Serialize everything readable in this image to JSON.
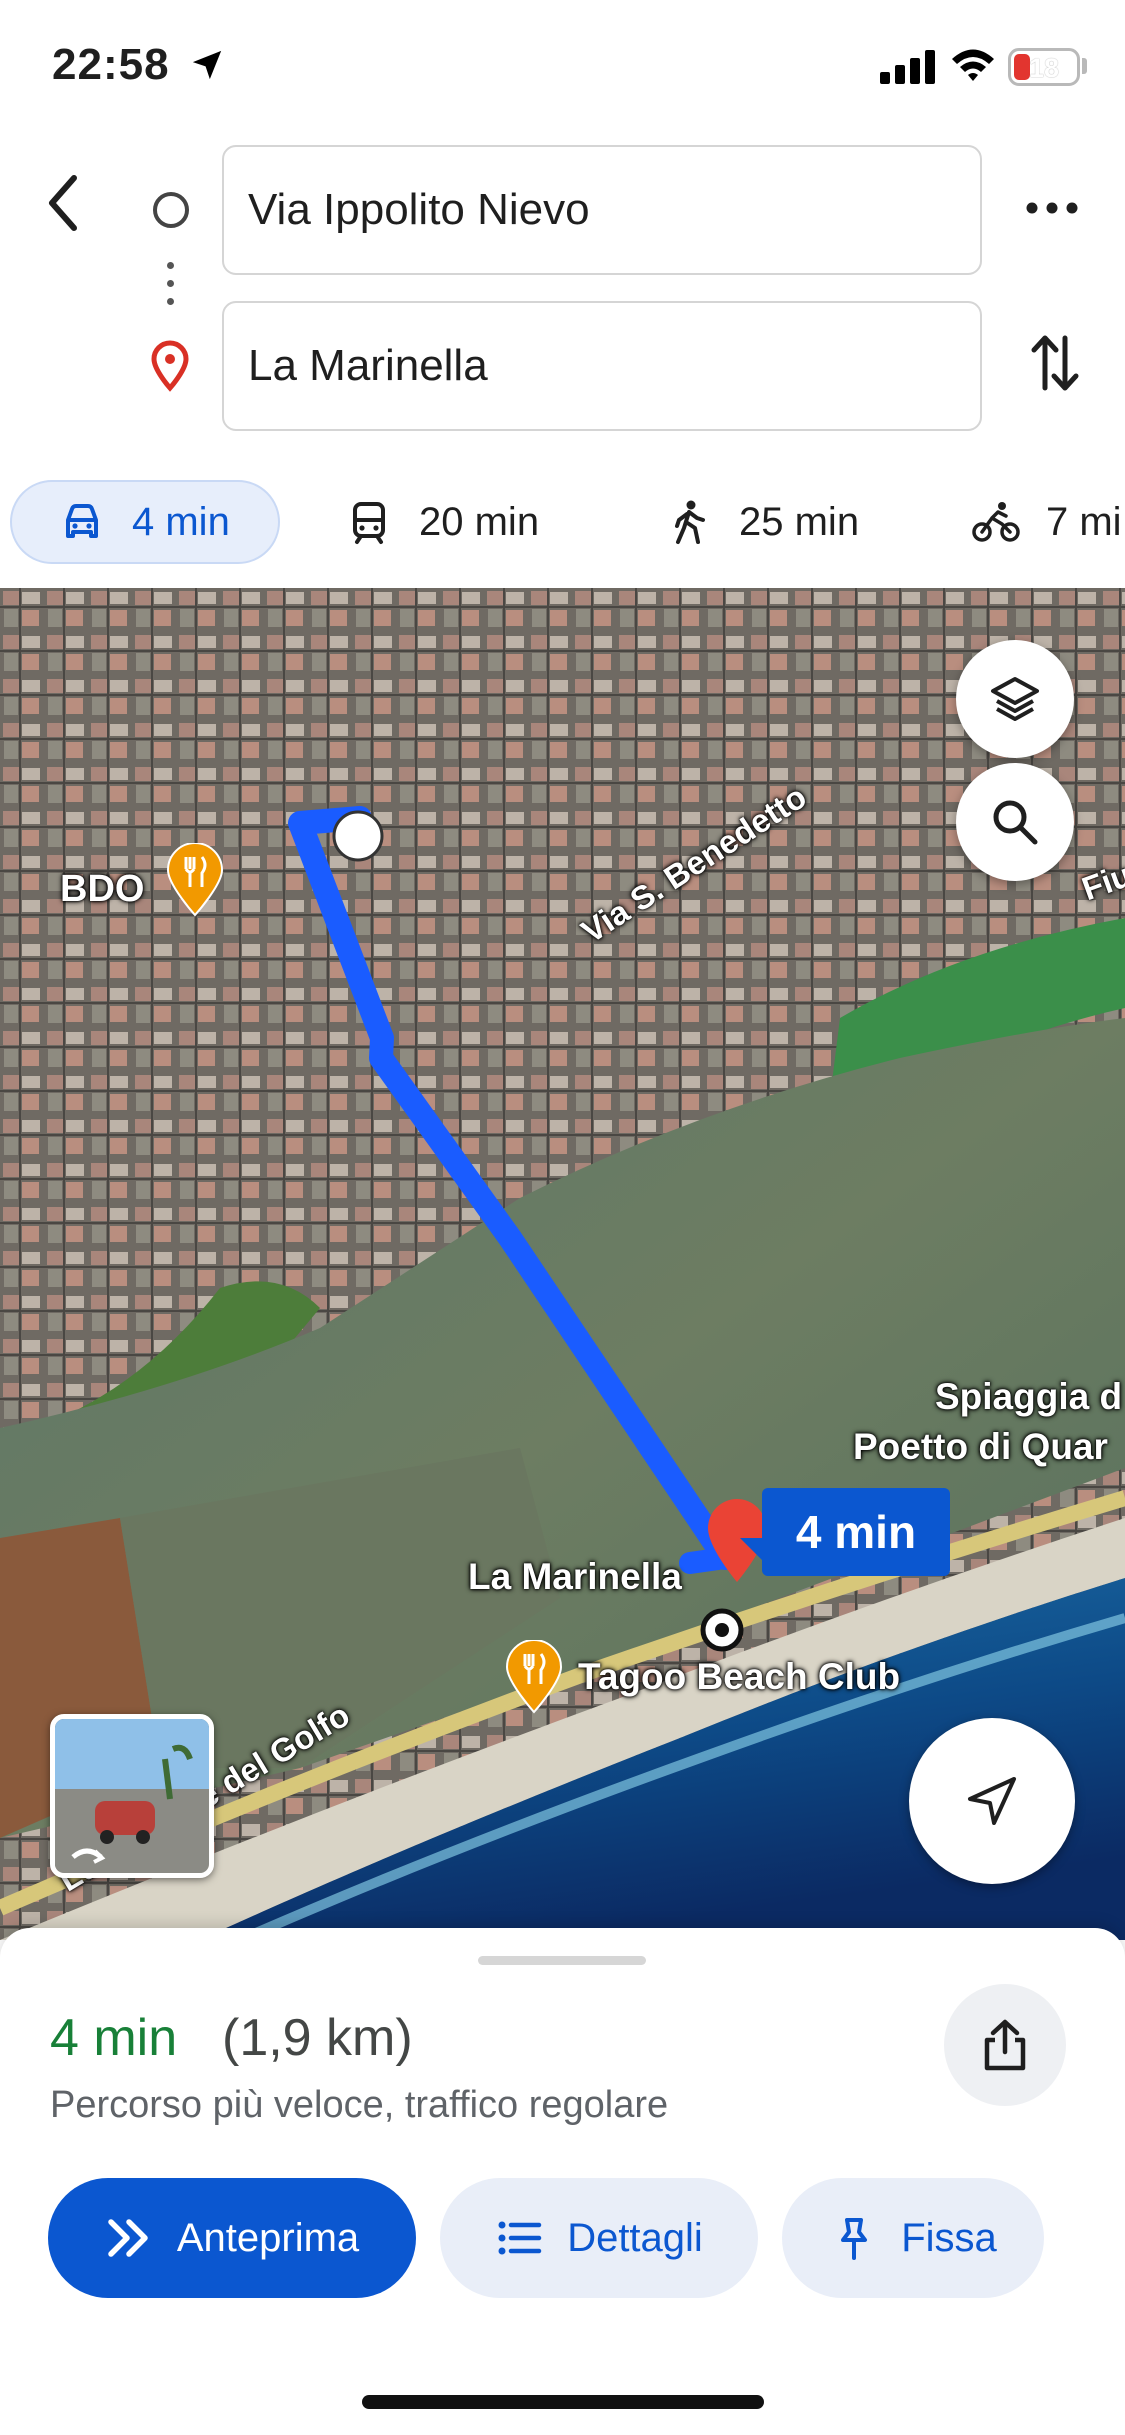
{
  "status_bar": {
    "time": "22:58",
    "battery": "18"
  },
  "directions": {
    "origin": "Via Ippolito Nievo",
    "destination": "La Marinella"
  },
  "modes": [
    {
      "icon": "car-icon",
      "time": "4 min",
      "active": true
    },
    {
      "icon": "train-icon",
      "time": "20 min"
    },
    {
      "icon": "walk-icon",
      "time": "25 min"
    },
    {
      "icon": "bike-icon",
      "time": "7 mi"
    }
  ],
  "map": {
    "labels": {
      "bdo": "BDO",
      "benedetto": "Via S. Benedetto",
      "fiu": "Fiu",
      "spiaggia": "Spiaggia d",
      "poetto": "Poetto di Quar",
      "marinella": "La Marinella",
      "tagoo": "Tagoo Beach Club",
      "lungomare": "Lungomare del Golfo"
    },
    "route_time": "4 min",
    "route_color": "#1a5cff"
  },
  "sheet": {
    "duration": "4 min",
    "distance": "(1,9 km)",
    "description": "Percorso più veloce, traffico regolare",
    "buttons": {
      "preview": "Anteprima",
      "details": "Dettagli",
      "pin": "Fissa"
    }
  },
  "colors": {
    "accent": "#0b57d0",
    "duration_green": "#188038",
    "route_blue": "#1a5cff",
    "pin_red": "#ea4335",
    "food_orange": "#f29900"
  }
}
